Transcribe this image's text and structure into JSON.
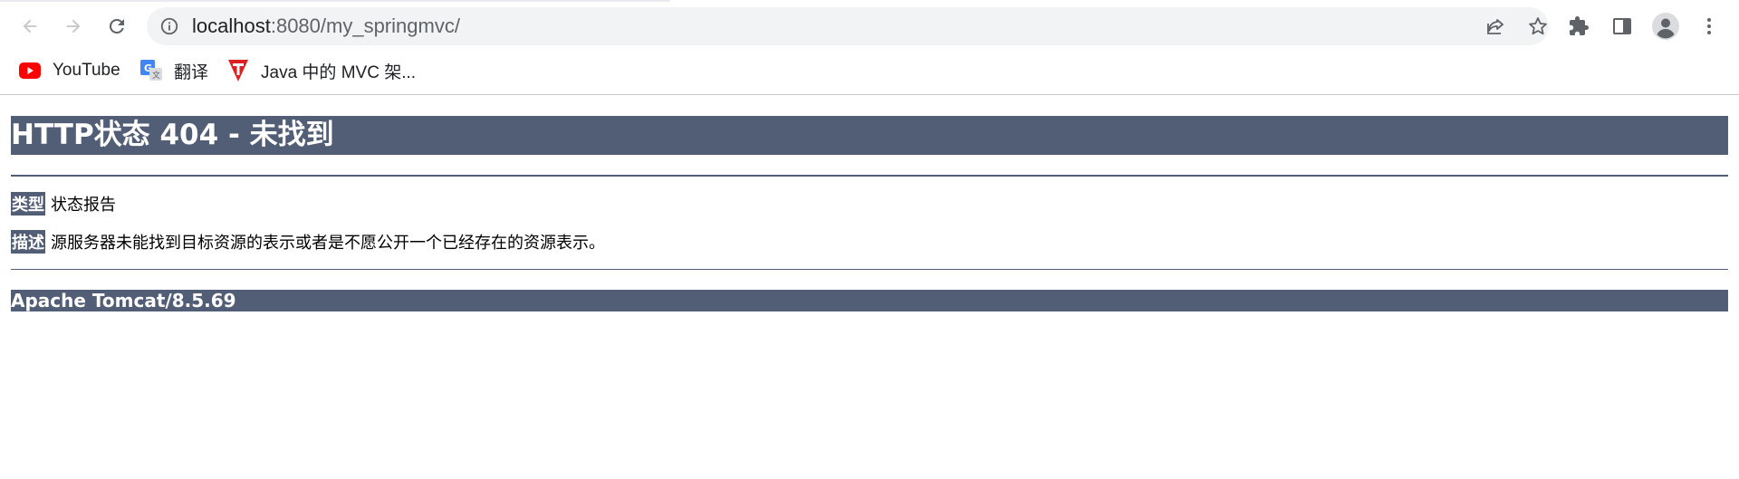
{
  "browser": {
    "address": {
      "host": "localhost",
      "path": ":8080/my_springmvc/"
    },
    "bookmarks": [
      {
        "label": "YouTube",
        "icon": "youtube-icon"
      },
      {
        "label": "翻译",
        "icon": "google-translate-icon"
      },
      {
        "label": "Java 中的 MVC 架...",
        "icon": "red-t-logo-icon"
      }
    ],
    "colors": {
      "toolbar_icon": "#5f6368",
      "omnibox_bg": "#f1f3f4"
    }
  },
  "page": {
    "title": "HTTP状态 404 - 未找到",
    "type_label": "类型",
    "type_value": "状态报告",
    "desc_label": "描述",
    "desc_value": "源服务器未能找到目标资源的表示或者是不愿公开一个已经存在的资源表示。",
    "footer": "Apache Tomcat/8.5.69",
    "colors": {
      "header_bg": "#525d76",
      "header_text": "#ffffff"
    }
  }
}
